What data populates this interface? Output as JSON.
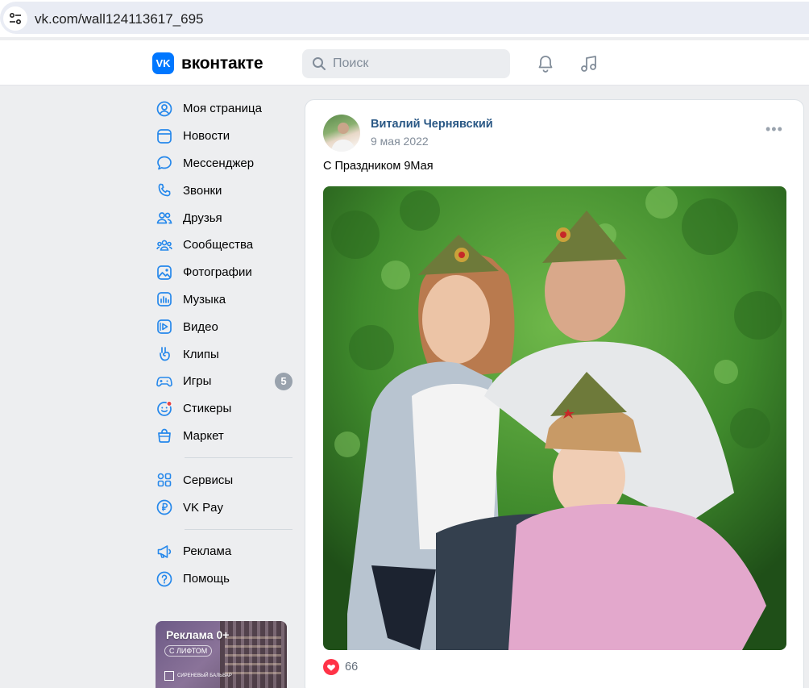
{
  "browser": {
    "url": "vk.com/wall124113617_695"
  },
  "header": {
    "logo_mark": "VK",
    "logo_text": "вконтакте",
    "search_placeholder": "Поиск"
  },
  "sidebar": {
    "items": [
      {
        "label": "Моя страница",
        "icon": "user-circle-icon"
      },
      {
        "label": "Новости",
        "icon": "newsfeed-icon"
      },
      {
        "label": "Мессенджер",
        "icon": "message-icon"
      },
      {
        "label": "Звонки",
        "icon": "phone-icon"
      },
      {
        "label": "Друзья",
        "icon": "friends-icon"
      },
      {
        "label": "Сообщества",
        "icon": "communities-icon"
      },
      {
        "label": "Фотографии",
        "icon": "photo-icon"
      },
      {
        "label": "Музыка",
        "icon": "music-icon"
      },
      {
        "label": "Видео",
        "icon": "video-icon"
      },
      {
        "label": "Клипы",
        "icon": "clips-icon"
      },
      {
        "label": "Игры",
        "icon": "gamepad-icon",
        "badge": "5"
      },
      {
        "label": "Стикеры",
        "icon": "sticker-icon"
      },
      {
        "label": "Маркет",
        "icon": "market-bag-icon"
      }
    ],
    "items2": [
      {
        "label": "Сервисы",
        "icon": "services-grid-icon"
      },
      {
        "label": "VK Pay",
        "icon": "vk-pay-icon"
      }
    ],
    "items3": [
      {
        "label": "Реклама",
        "icon": "megaphone-icon"
      },
      {
        "label": "Помощь",
        "icon": "help-icon"
      }
    ],
    "ad": {
      "title": "Реклама 0+",
      "subtitle": "С ЛИФТОМ",
      "brand": "СИРЕНЕВЫЙ БАЛЬВАР"
    }
  },
  "post": {
    "author": "Виталий Чернявский",
    "date": "9 мая 2022",
    "text": "С Праздником 9Мая",
    "likes": "66"
  },
  "colors": {
    "accent": "#0077ff",
    "link": "#2a5885",
    "icon": "#2688eb",
    "like": "#ff3347"
  }
}
